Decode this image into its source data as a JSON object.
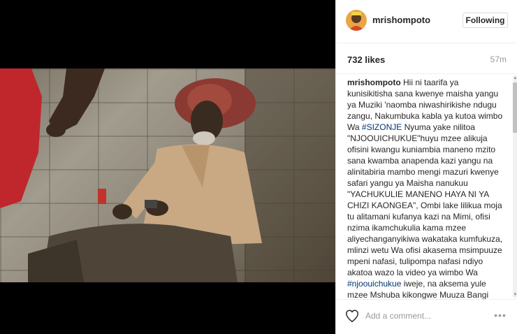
{
  "post": {
    "username": "mrishompoto",
    "follow_label": "Following",
    "likes": "732 likes",
    "time_ago": "57m"
  },
  "caption": {
    "username": "mrishompoto",
    "text1": " Hii ni taarifa ya kunisikitisha sana kwenye maisha yangu ya Muziki 'naomba niwashirikishe ndugu zangu, Nakumbuka kabla ya kutoa wimbo Wa ",
    "tag1": "#SIZONJE",
    "text2": " Nyuma yake nilitoa \"NJOOUICHUKUE\"huyu mzee alikuja ofisini kwangu kuniambia maneno mzito sana kwamba anapenda kazi yangu na alinitabiria mambo mengi mazuri kwenye safari yangu ya Maisha nanukuu \"YACHUKULIE MANENO HAYA NI YA CHIZI KAONGEA\", Ombi lake lilikua moja tu alitamani kufanya kazi na Mimi, ofisi nzima ikamchukulia kama mzee aliyechanganyikiwa wakataka kumfukuza, mlinzi wetu Wa ofisi akasema msimpuuze mpeni nafasi, tulipompa nafasi ndiyo akatoa wazo la video ya wimbo Wa ",
    "tag2": "#njoouichukue",
    "text3": " iweje, na aksema yule mzee Mshuba kikongwe Muuza Bangi ataigiza yeye mwenyewe tulicheka Sana maana wazo"
  },
  "comment": {
    "placeholder": "Add a comment..."
  },
  "colors": {
    "hashtag": "#003569",
    "border": "#efefef",
    "muted": "#999999"
  }
}
